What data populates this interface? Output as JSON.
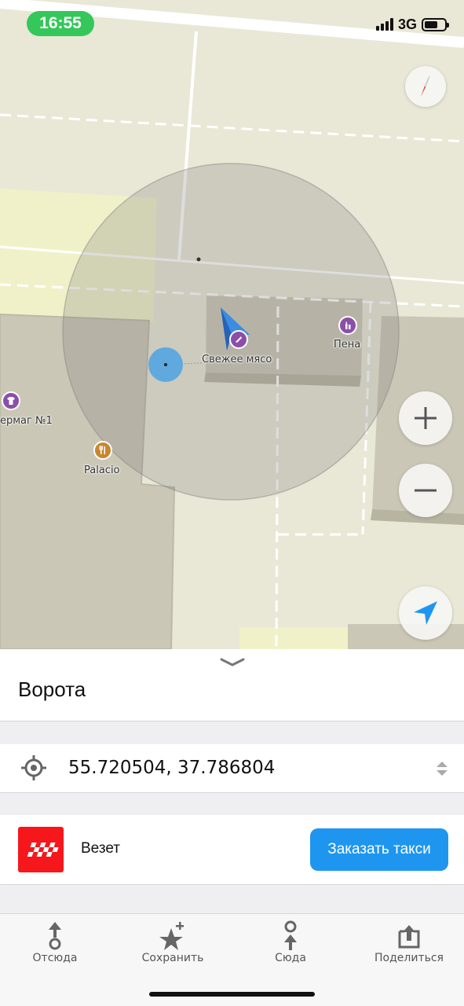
{
  "status_bar": {
    "time": "16:55",
    "network": "3G"
  },
  "map": {
    "pois": [
      {
        "name": "Свежее мясо"
      },
      {
        "name": "Пена"
      },
      {
        "name": "ермаг №1"
      },
      {
        "name": "Palacio"
      }
    ]
  },
  "place": {
    "title": "Ворота",
    "coordinates": "55.720504, 37.786804"
  },
  "taxi": {
    "provider": "Везет",
    "button": "Заказать такси"
  },
  "tabs": [
    {
      "label": "Отсюда",
      "icon": "route-from-icon"
    },
    {
      "label": "Сохранить",
      "icon": "star-plus-icon"
    },
    {
      "label": "Сюда",
      "icon": "route-to-icon"
    },
    {
      "label": "Поделиться",
      "icon": "share-icon"
    }
  ],
  "colors": {
    "status_time_bg": "#34c759",
    "accent_blue": "#1e96f0",
    "taxi_logo_red": "#f5171c",
    "map_background": "#e9e7d6"
  }
}
